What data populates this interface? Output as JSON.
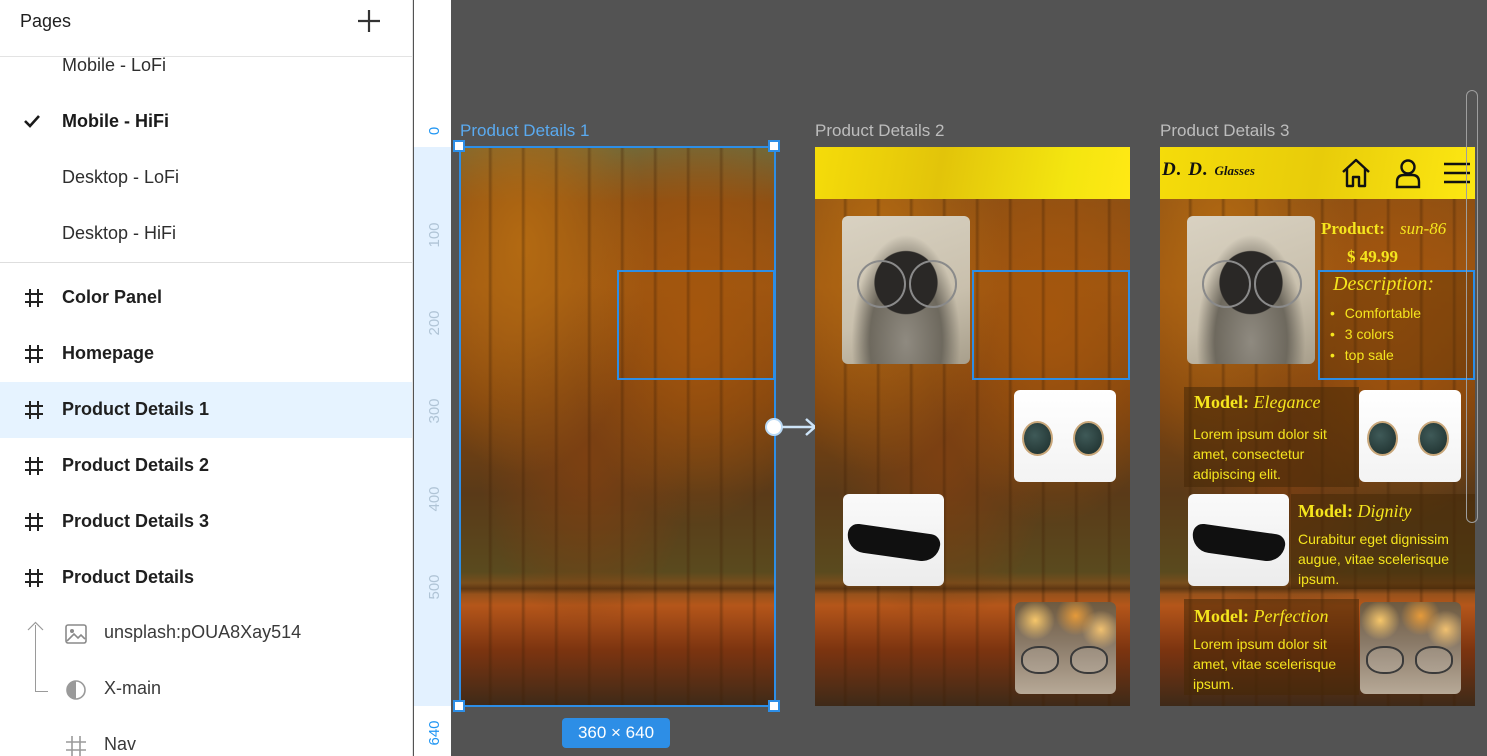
{
  "pages_panel": {
    "title": "Pages",
    "pages": [
      {
        "label": "Mobile - LoFi",
        "active": false
      },
      {
        "label": "Mobile - HiFi",
        "active": true
      },
      {
        "label": "Desktop - LoFi",
        "active": false
      },
      {
        "label": "Desktop - HiFi",
        "active": false
      }
    ]
  },
  "layers": [
    {
      "label": "Color Panel",
      "selected": false
    },
    {
      "label": "Homepage",
      "selected": false
    },
    {
      "label": "Product Details 1",
      "selected": true
    },
    {
      "label": "Product Details 2",
      "selected": false
    },
    {
      "label": "Product Details 3",
      "selected": false
    },
    {
      "label": "Product Details",
      "selected": false
    }
  ],
  "sub_layers": [
    {
      "label": "unsplash:pOUA8Xay514",
      "icon": "image-icon"
    },
    {
      "label": "X-main",
      "icon": "component-icon"
    },
    {
      "label": "Nav",
      "icon": "frame-hash-icon"
    }
  ],
  "ruler": {
    "marks": [
      "0",
      "100",
      "200",
      "300",
      "400",
      "500",
      "640"
    ]
  },
  "canvas": {
    "frames": [
      {
        "label": "Product Details 1"
      },
      {
        "label": "Product Details 2"
      },
      {
        "label": "Product Details 3"
      }
    ],
    "selection_size": "360 × 640"
  },
  "product_details_3": {
    "brand_main": "D. D.",
    "brand_sub": "Glasses",
    "product_label": "Product:",
    "product_code": "sun-86",
    "price": "$ 49.99",
    "description_title": "Description:",
    "bullets": [
      "Comfortable",
      "3 colors",
      "top sale"
    ],
    "models": [
      {
        "label": "Model:",
        "name": "Elegance",
        "text": "Lorem ipsum dolor sit amet, consectetur adipiscing elit."
      },
      {
        "label": "Model:",
        "name": "Dignity",
        "text": "Curabitur eget dignissim augue, vitae scelerisque ipsum."
      },
      {
        "label": "Model:",
        "name": "Perfection",
        "text": "Lorem ipsum dolor sit amet, vitae scelerisque ipsum."
      }
    ]
  },
  "colors": {
    "accent": "#2d8ee6",
    "brand_yellow": "#f5e51d",
    "canvas_bg": "#535353"
  }
}
